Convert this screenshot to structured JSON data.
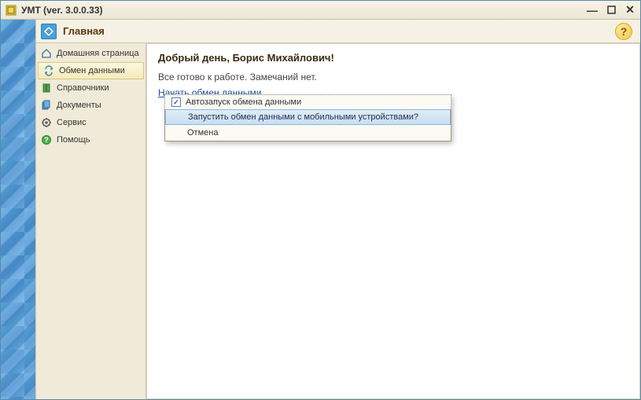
{
  "window": {
    "title": "УМТ (ver. 3.0.0.33)"
  },
  "header": {
    "title": "Главная"
  },
  "sidebar": {
    "items": [
      {
        "label": "Домашняя страница"
      },
      {
        "label": "Обмен данными"
      },
      {
        "label": "Справочники"
      },
      {
        "label": "Документы"
      },
      {
        "label": "Сервис"
      },
      {
        "label": "Помощь"
      }
    ]
  },
  "content": {
    "greeting": "Добрый день, Борис Михайлович!",
    "status": "Все готово к работе. Замечаний нет.",
    "link": "Начать обмен данными"
  },
  "popup": {
    "checkbox_label": "Автозапуск обмена данными",
    "checkbox_checked": "✓",
    "action_label": "Запустить обмен данными с мобильными устройствами?",
    "cancel_label": "Отмена"
  }
}
